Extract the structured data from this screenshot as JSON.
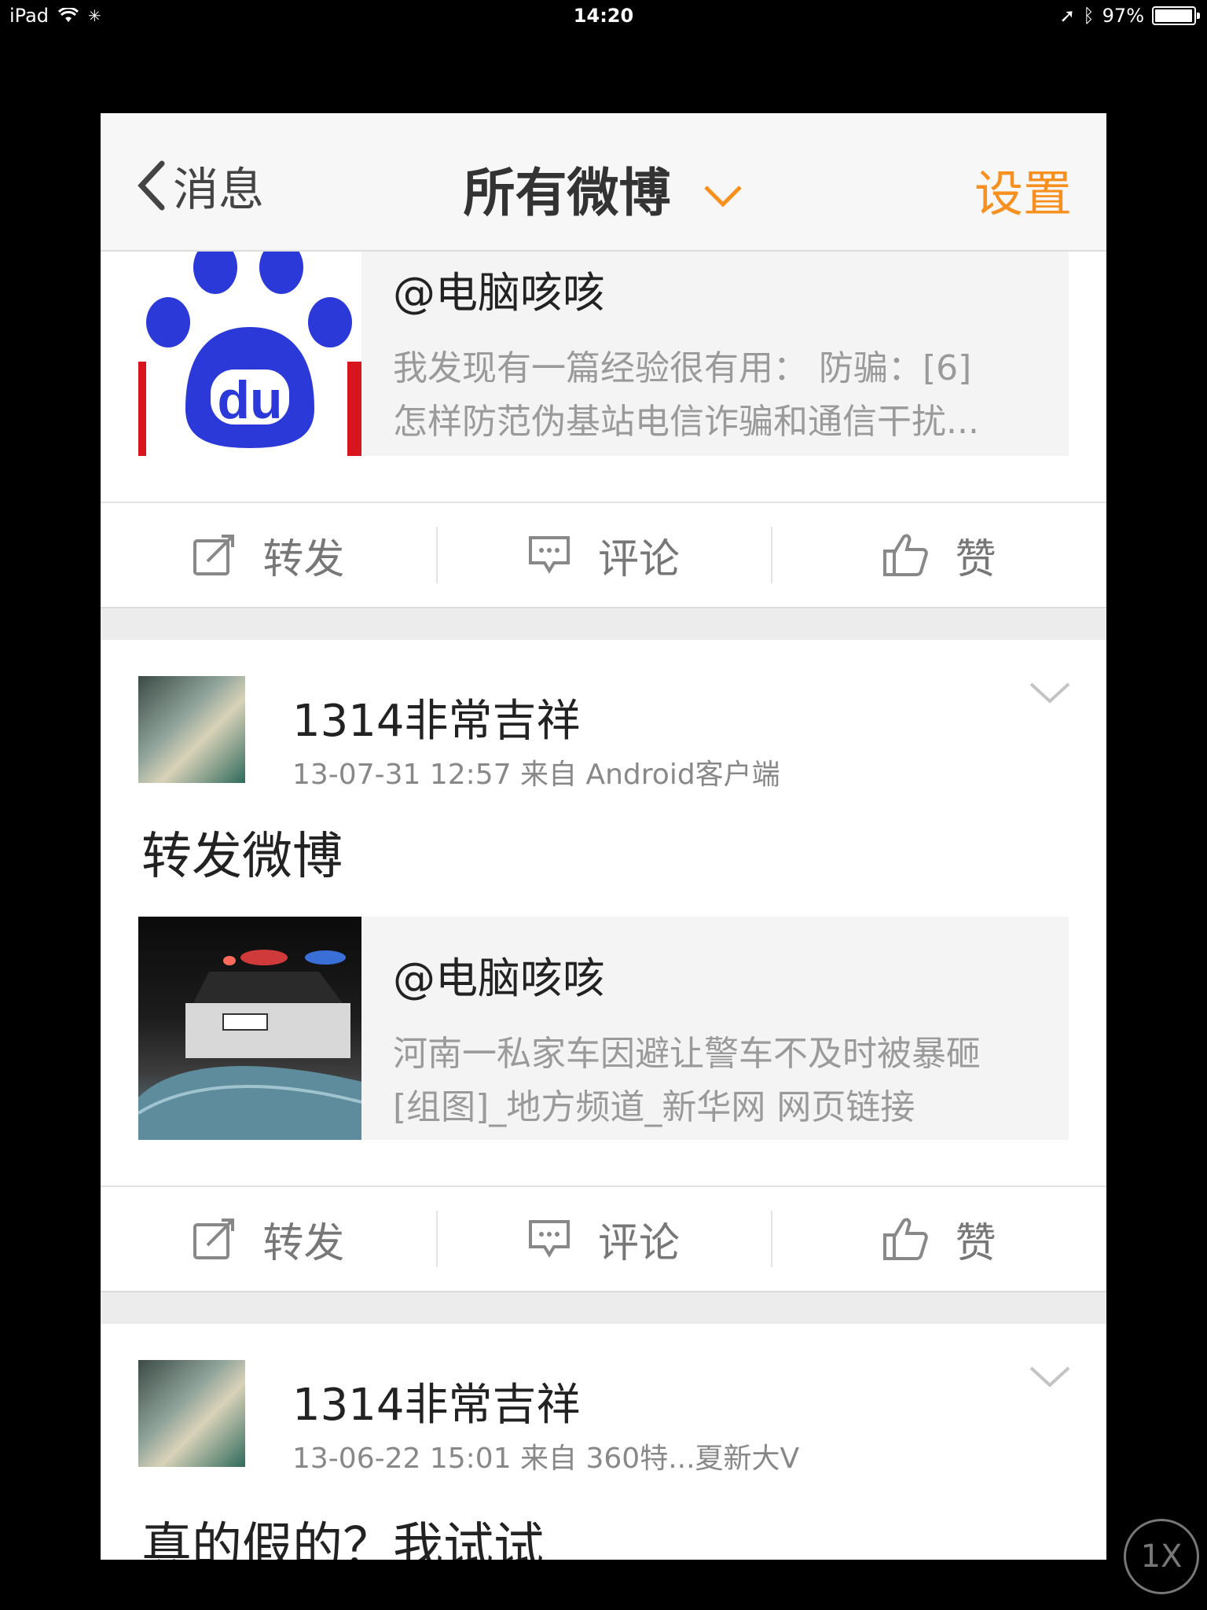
{
  "status_bar": {
    "device": "iPad",
    "time": "14:20",
    "battery": "97%",
    "battery_level": 0.97
  },
  "navbar": {
    "back_label": "消息",
    "title": "所有微博",
    "settings_label": "设置"
  },
  "posts": [
    {
      "repost": {
        "name": "@电脑咳咳",
        "desc_line1": "我发现有一篇经验很有用： 防骗：[6]",
        "desc_line2": "怎样防范伪基站电信诈骗和通信干扰..."
      },
      "actions": {
        "repost": "转发",
        "comment": "评论",
        "like": "赞"
      }
    },
    {
      "user_name": "1314非常吉祥",
      "meta": "13-07-31 12:57   来自 Android客户端",
      "text": "转发微博",
      "repost": {
        "name": "@电脑咳咳",
        "desc_line1": "河南一私家车因避让警车不及时被暴砸",
        "desc_line2": "[组图]_地方频道_新华网 网页链接"
      },
      "actions": {
        "repost": "转发",
        "comment": "评论",
        "like": "赞"
      }
    },
    {
      "user_name": "1314非常吉祥",
      "meta": "13-06-22 15:01   来自 360特...夏新大V",
      "text": "真的假的？我试试"
    }
  ],
  "overlay": {
    "scale_button": "1X"
  },
  "colors": {
    "accent": "#f7901e",
    "baidu_blue": "#2a39d8",
    "baidu_red": "#d8141c"
  }
}
